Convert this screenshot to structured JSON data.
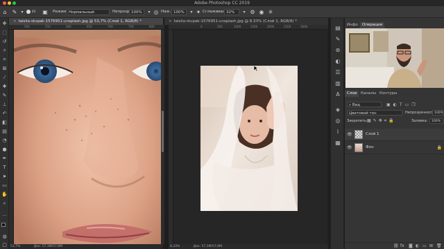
{
  "window": {
    "title": "Adobe Photoshop CC 2019",
    "traffic_lights": [
      "#ff5f57",
      "#febc2e",
      "#28c840"
    ]
  },
  "options_bar": {
    "brush_size": "45",
    "mode_label": "Режим:",
    "mode_value": "Нормальный",
    "opacity_label": "Непрозр.:",
    "opacity_value": "100%",
    "pressure_label": "Наж.:",
    "pressure_value": "100%",
    "smoothing_label": "Сглаживание:",
    "smoothing_value": "32%"
  },
  "documents": [
    {
      "tab_title": "taisiia-stupak-1576951-unsplash.jpg @ 53,7% (Слой 1, RGB/8) *",
      "zoom": "53,7%",
      "doc_size": "Док: 57,1M/57,6M"
    },
    {
      "tab_title": "taisiia-stupak-1576951-unsplash.jpg @ 8,33% (Слой 1, RGB/8) *",
      "zoom": "8,33%",
      "doc_size": "Док: 57,1M/57,6M"
    }
  ],
  "ruler_left": [
    "500",
    "550",
    "600",
    "650",
    "700",
    "750",
    "800"
  ],
  "ruler_right": [
    "0",
    "500",
    "1000",
    "1500",
    "2000",
    "2500",
    "3000"
  ],
  "panels": {
    "top_tabs": [
      "Инфо",
      "Операции"
    ],
    "layer_tabs": [
      "Слои",
      "Каналы",
      "Контуры"
    ],
    "filter_kind": "Вид",
    "blend_mode": "Цветовой тон",
    "opacity_label": "Непрозрачность:",
    "opacity_value": "100%",
    "lock_label": "Закрепить:",
    "fill_label": "Заливка:",
    "fill_value": "100%",
    "layers": [
      {
        "name": "Слой 1",
        "visible": true,
        "locked": false
      },
      {
        "name": "Фон",
        "visible": true,
        "locked": true
      }
    ]
  },
  "accent_color": "#3a8ee6"
}
